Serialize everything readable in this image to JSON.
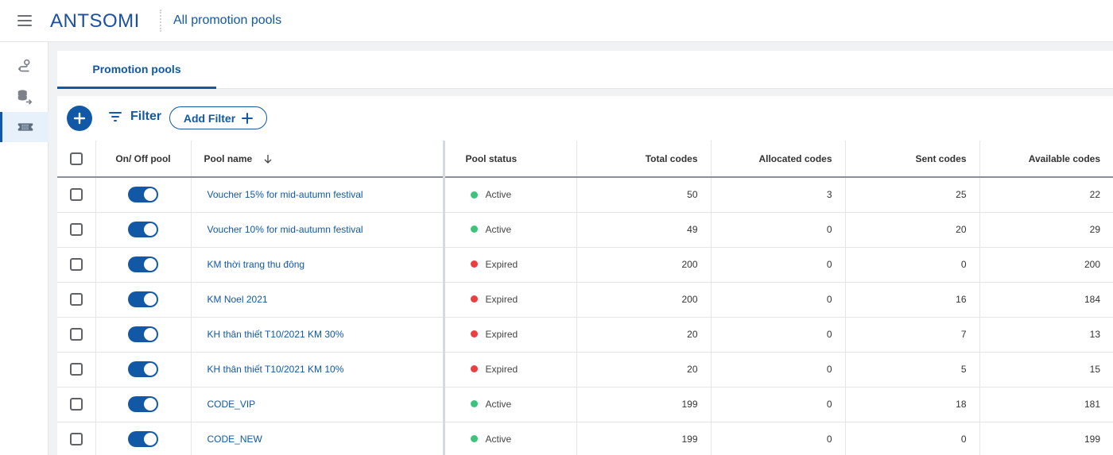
{
  "app": {
    "logo_text": "ANTSOMI",
    "page_title": "All promotion pools"
  },
  "sidebar": {
    "items": [
      {
        "icon": "journey-icon",
        "active": false
      },
      {
        "icon": "database-export-icon",
        "active": false
      },
      {
        "icon": "ticket-icon",
        "active": true
      }
    ]
  },
  "tabs": [
    {
      "label": "Promotion pools",
      "active": true
    }
  ],
  "toolbar": {
    "filter_label": "Filter",
    "add_filter_label": "Add Filter"
  },
  "table": {
    "headers": {
      "toggle": "On/ Off pool",
      "name": "Pool name",
      "status": "Pool status",
      "total": "Total codes",
      "allocated": "Allocated codes",
      "sent": "Sent codes",
      "available": "Available codes"
    },
    "rows": [
      {
        "name": "Voucher 15% for mid-autumn festival",
        "status": "Active",
        "total": "50",
        "allocated": "3",
        "sent": "25",
        "available": "22",
        "enabled": true
      },
      {
        "name": "Voucher 10% for mid-autumn festival",
        "status": "Active",
        "total": "49",
        "allocated": "0",
        "sent": "20",
        "available": "29",
        "enabled": true
      },
      {
        "name": "KM thời trang thu đông",
        "status": "Expired",
        "total": "200",
        "allocated": "0",
        "sent": "0",
        "available": "200",
        "enabled": true
      },
      {
        "name": "KM Noel 2021",
        "status": "Expired",
        "total": "200",
        "allocated": "0",
        "sent": "16",
        "available": "184",
        "enabled": true
      },
      {
        "name": "KH thân thiết T10/2021 KM 30%",
        "status": "Expired",
        "total": "20",
        "allocated": "0",
        "sent": "7",
        "available": "13",
        "enabled": true
      },
      {
        "name": "KH thân thiết T10/2021 KM 10%",
        "status": "Expired",
        "total": "20",
        "allocated": "0",
        "sent": "5",
        "available": "15",
        "enabled": true
      },
      {
        "name": "CODE_VIP",
        "status": "Active",
        "total": "199",
        "allocated": "0",
        "sent": "18",
        "available": "181",
        "enabled": true
      },
      {
        "name": "CODE_NEW",
        "status": "Active",
        "total": "199",
        "allocated": "0",
        "sent": "0",
        "available": "199",
        "enabled": true
      }
    ]
  },
  "colors": {
    "primary": "#1158a6",
    "active_status": "#3cc47c",
    "expired_status": "#e9403f"
  }
}
